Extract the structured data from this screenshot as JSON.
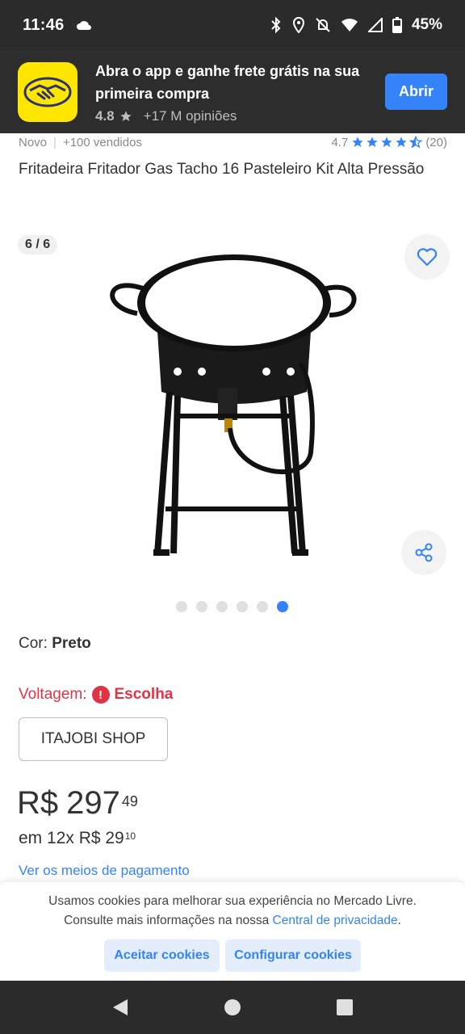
{
  "status_bar": {
    "time": "11:46",
    "battery": "45%"
  },
  "app_banner": {
    "title": "Abra o app e ganhe frete grátis na sua primeira compra",
    "rating": "4.8",
    "reviews": "+17 M opiniões",
    "open_label": "Abrir"
  },
  "product": {
    "condition": "Novo",
    "sold": "+100 vendidos",
    "rating": "4.7",
    "rating_stars": 4.5,
    "reviews_count": "(20)",
    "title": "Fritadeira Fritador Gas Tacho 16 Pasteleiro Kit Alta Pressão",
    "image_counter": "6 / 6",
    "gallery_total": 6,
    "gallery_active_index": 6
  },
  "variations": {
    "color_label": "Cor: ",
    "color_value": "Preto",
    "voltage_label": "Voltagem:",
    "voltage_choose": "Escolha",
    "seller_option": "ITAJOBI SHOP"
  },
  "price": {
    "currency": "R$",
    "integer": "297",
    "cents": "49",
    "installments_prefix": "em 12x R$ 29",
    "installments_cents": "10",
    "payment_link": "Ver os meios de pagamento"
  },
  "cookies": {
    "text_line1": "Usamos cookies para melhorar sua experiência no Mercado Livre.",
    "text_line2_prefix": "Consulte mais informações na nossa ",
    "privacy_link": "Central de privacidade",
    "text_line2_suffix": ".",
    "accept_label": "Aceitar cookies",
    "configure_label": "Configurar cookies"
  },
  "colors": {
    "accent": "#3483fa",
    "error": "#e13344",
    "brand_yellow": "#ffe600"
  },
  "icons": {
    "favorite": "heart-icon",
    "share": "share-icon",
    "alert": "exclamation-icon"
  }
}
